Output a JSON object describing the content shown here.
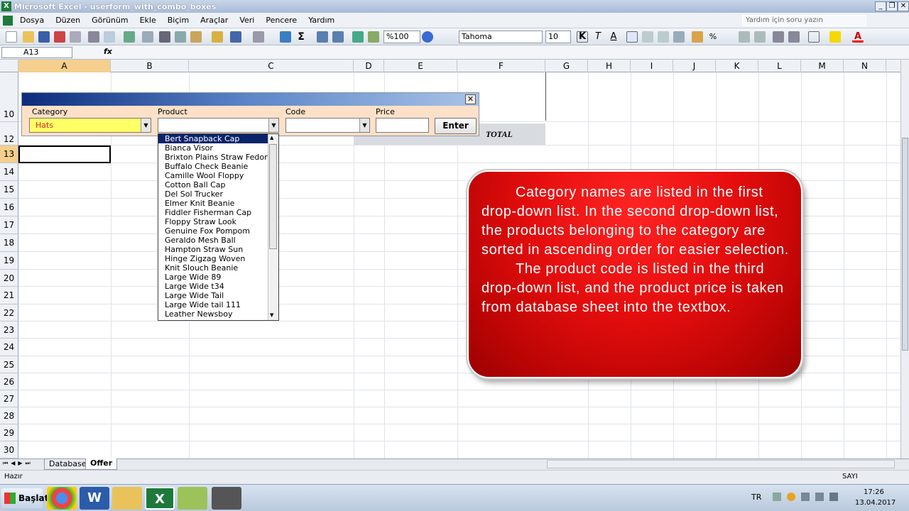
{
  "window": {
    "title": "Microsoft Excel - userform_with_combo_boxes"
  },
  "menu": [
    "Dosya",
    "Düzen",
    "Görünüm",
    "Ekle",
    "Biçim",
    "Araçlar",
    "Veri",
    "Pencere",
    "Yardım"
  ],
  "help_placeholder": "Yardım için soru yazın",
  "toolbar": {
    "zoom": "%100",
    "font_name": "Tahoma",
    "font_size": "10"
  },
  "namebox": "A13",
  "fx_label": "fx",
  "columns": [
    "A",
    "B",
    "C",
    "D",
    "E",
    "F",
    "G",
    "H",
    "I",
    "J",
    "K",
    "L",
    "M",
    "N"
  ],
  "rows": [
    "10",
    "12",
    "13",
    "14",
    "15",
    "16",
    "17",
    "18",
    "19",
    "20",
    "21",
    "22",
    "23",
    "24",
    "25",
    "26",
    "27",
    "28",
    "29",
    "30"
  ],
  "sheet": {
    "total_label": "TOTAL",
    "tabs": [
      "Database",
      "Offer"
    ],
    "active_tab": "Offer"
  },
  "status": {
    "left": "Hazır",
    "right": "SAYI"
  },
  "userform": {
    "labels": {
      "category": "Category",
      "product": "Product",
      "code": "Code",
      "price": "Price"
    },
    "category_value": "Hats",
    "enter_label": "Enter",
    "close": "✕",
    "product_list": [
      "Bert Snapback Cap",
      "Bianca Visor",
      "Brixton Plains Straw Fedora",
      "Buffalo Check Beanie",
      "Camille Wool Floppy",
      "Cotton Ball Cap",
      "Del Sol Trucker",
      "Elmer Knit Beanie",
      "Fiddler Fisherman Cap",
      "Floppy Straw Look",
      "Genuine Fox Pompom",
      "Geraldo Mesh Ball",
      "Hampton Straw Sun",
      "Hinge Zigzag Woven",
      "Knit Slouch Beanie",
      "Large Wide 89",
      "Large Wide t34",
      "Large Wide Tail",
      "Large Wide tail 111",
      "Leather Newsboy"
    ],
    "selected_index": 0
  },
  "callout": {
    "p1": "Category names are listed in the first drop-down list. In the second drop-down list, the products belonging to the category are sorted in ascending order for easier selection.",
    "p2": "The product code is listed in the third drop-down list, and the product price is taken from database sheet into the textbox."
  },
  "taskbar": {
    "start": "Başlat",
    "lang": "TR",
    "time": "17:26",
    "date": "13.04.2017"
  },
  "colors": {
    "callout": "#e40d0d",
    "formbar": "#0b2c7c",
    "form_bg": "#fde0c8",
    "combo_highlight": "#ffff66"
  }
}
